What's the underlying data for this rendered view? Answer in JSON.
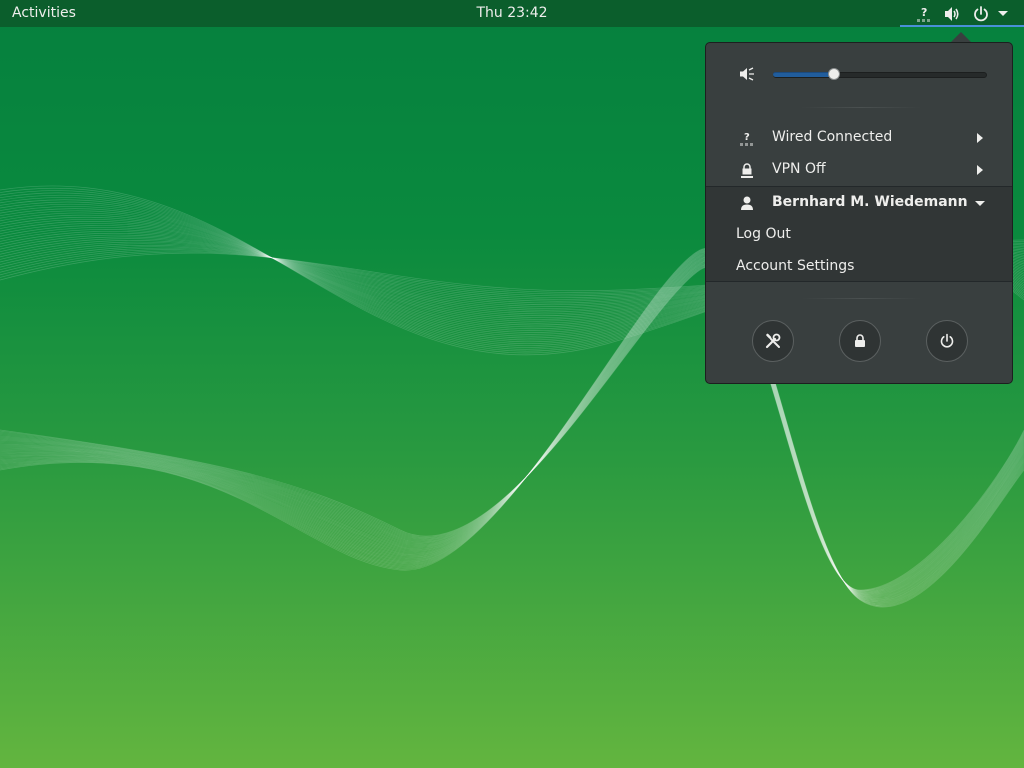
{
  "topbar": {
    "activities_label": "Activities",
    "clock": "Thu 23:42",
    "tray_icons": [
      "network-unknown-icon",
      "volume-icon",
      "power-icon",
      "menu-arrow-down-icon"
    ]
  },
  "system_menu": {
    "volume": {
      "icon": "volume-muted-icon",
      "level": 0.29
    },
    "network": {
      "icon": "network-wired-unknown-icon",
      "label": "Wired Connected"
    },
    "vpn": {
      "icon": "vpn-lock-icon",
      "label": "VPN Off"
    },
    "user": {
      "icon": "user-icon",
      "name": "Bernhard M. Wiedemann",
      "submenu": [
        "Log Out",
        "Account Settings"
      ]
    },
    "actions": [
      "settings-icon",
      "lock-icon",
      "power-icon"
    ]
  },
  "colors": {
    "topbar": "#0b5e2c",
    "menu_bg": "#393f3f",
    "accent": "#215d9c",
    "wallpaper_top": "#05803e",
    "wallpaper_bottom": "#63b53f"
  }
}
